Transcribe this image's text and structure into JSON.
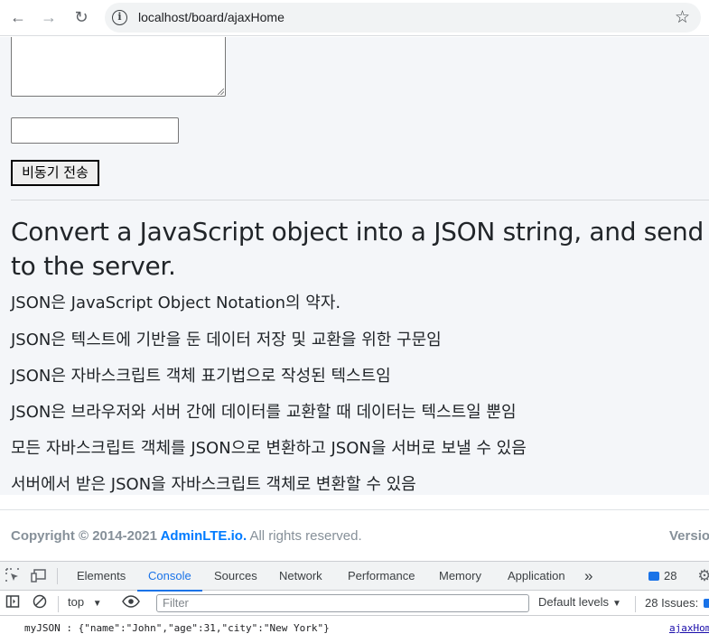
{
  "browser": {
    "url": "localhost/board/ajaxHome",
    "back_glyph": "←",
    "forward_glyph": "→",
    "reload_glyph": "↻",
    "info_glyph": "i",
    "star_glyph": "☆"
  },
  "form": {
    "textarea_value": "",
    "input_value": "",
    "submit_label": "비동기 전송"
  },
  "content": {
    "heading": "Convert a JavaScript object into a JSON string, and send it to the server.",
    "lines": [
      "JSON은 JavaScript Object Notation의 약자.",
      "JSON은 텍스트에 기반을 둔 데이터 저장 및 교환을 위한 구문임",
      "JSON은 자바스크립트 객체 표기법으로 작성된 텍스트임",
      "JSON은 브라우저와 서버 간에 데이터를 교환할 때 데이터는 텍스트일 뿐임",
      "모든 자바스크립트 객체를 JSON으로 변환하고 JSON을 서버로 보낼 수 있음",
      "서버에서 받은 JSON을 자바스크립트 객체로 변환할 수 있음"
    ]
  },
  "footer": {
    "copyright_prefix": "Copyright © 2014-2021 ",
    "brand_link": "AdminLTE.io.",
    "rights": " All rights reserved.",
    "version_label": "Version"
  },
  "devtools": {
    "tabs": [
      "Elements",
      "Console",
      "Sources",
      "Network",
      "Performance",
      "Memory",
      "Application"
    ],
    "active_tab": "Console",
    "more_tabs_glyph": "»",
    "issues_count": "28",
    "context": "top",
    "filter_placeholder": "Filter",
    "levels_label": "Default levels",
    "issues_label": "28 Issues:",
    "console_message": "myJSON : {\"name\":\"John\",\"age\":31,\"city\":\"New York\"}",
    "console_source": "ajaxHome"
  },
  "colors": {
    "accent": "#1a73e8",
    "brand_link": "#007bff",
    "page_bg": "#f4f6f9"
  }
}
